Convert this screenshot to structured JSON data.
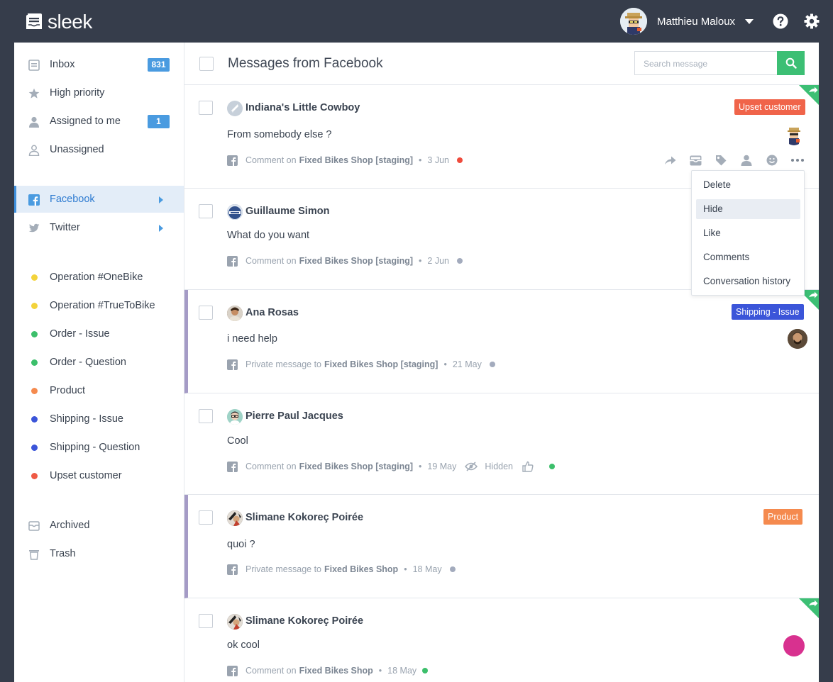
{
  "app": {
    "name": "sleek"
  },
  "user": {
    "name": "Matthieu Maloux"
  },
  "sidebar": {
    "inbox": {
      "label": "Inbox",
      "count": "831"
    },
    "high_priority": "High priority",
    "assigned": {
      "label": "Assigned to me",
      "count": "1"
    },
    "unassigned": "Unassigned",
    "facebook": "Facebook",
    "twitter": "Twitter",
    "tags": [
      {
        "label": "Operation #OneBike",
        "color": "#f3d33b"
      },
      {
        "label": "Operation #TrueToBike",
        "color": "#f3d33b"
      },
      {
        "label": "Order - Issue",
        "color": "#3cbf6b"
      },
      {
        "label": "Order - Question",
        "color": "#3cbf6b"
      },
      {
        "label": "Product",
        "color": "#f58a4e"
      },
      {
        "label": "Shipping - Issue",
        "color": "#3b55d9"
      },
      {
        "label": "Shipping - Question",
        "color": "#3b55d9"
      },
      {
        "label": "Upset customer",
        "color": "#ef5a45"
      }
    ],
    "archived": "Archived",
    "trash": "Trash"
  },
  "header": {
    "title": "Messages from Facebook",
    "search_placeholder": "Search message"
  },
  "messages": [
    {
      "author": "Indiana's Little Cowboy",
      "text": "From somebody else ?",
      "type": "Comment on",
      "page": "Fixed Bikes Shop [staging]",
      "date": "3 Jun",
      "status_color": "#ef4b3c",
      "tag": "Upset customer",
      "tag_color": "#f0644a"
    },
    {
      "author": "Guillaume Simon",
      "text": "What do you want",
      "type": "Comment on",
      "page": "Fixed Bikes Shop [staging]",
      "date": "2 Jun",
      "status_color": "#a3abbd"
    },
    {
      "author": "Ana Rosas",
      "text": "i need help",
      "type": "Private message to",
      "page": "Fixed Bikes Shop [staging]",
      "date": "21 May",
      "status_color": "#a3abbd",
      "tag": "Shipping - Issue",
      "tag_color": "#3b55d9"
    },
    {
      "author": "Pierre Paul Jacques",
      "text": "Cool",
      "type": "Comment on",
      "page": "Fixed Bikes Shop [staging]",
      "date": "19 May",
      "hidden_label": "Hidden",
      "status_color": "#3cbf6b"
    },
    {
      "author": "Slimane Kokoreç Poirée",
      "text": "quoi ?",
      "type": "Private message to",
      "page": "Fixed Bikes Shop",
      "date": "18 May",
      "status_color": "#a3abbd",
      "tag": "Product",
      "tag_color": "#f58a4e"
    },
    {
      "author": "Slimane Kokoreç Poirée",
      "text": "ok cool",
      "type": "Comment on",
      "page": "Fixed Bikes Shop",
      "date": "18 May",
      "status_color": "#3cbf6b"
    }
  ],
  "dropdown": [
    "Delete",
    "Hide",
    "Like",
    "Comments",
    "Conversation history"
  ],
  "colors": {
    "brand_bg": "#363d4b",
    "accent": "#3cbf74",
    "active": "#3e8fdc"
  }
}
